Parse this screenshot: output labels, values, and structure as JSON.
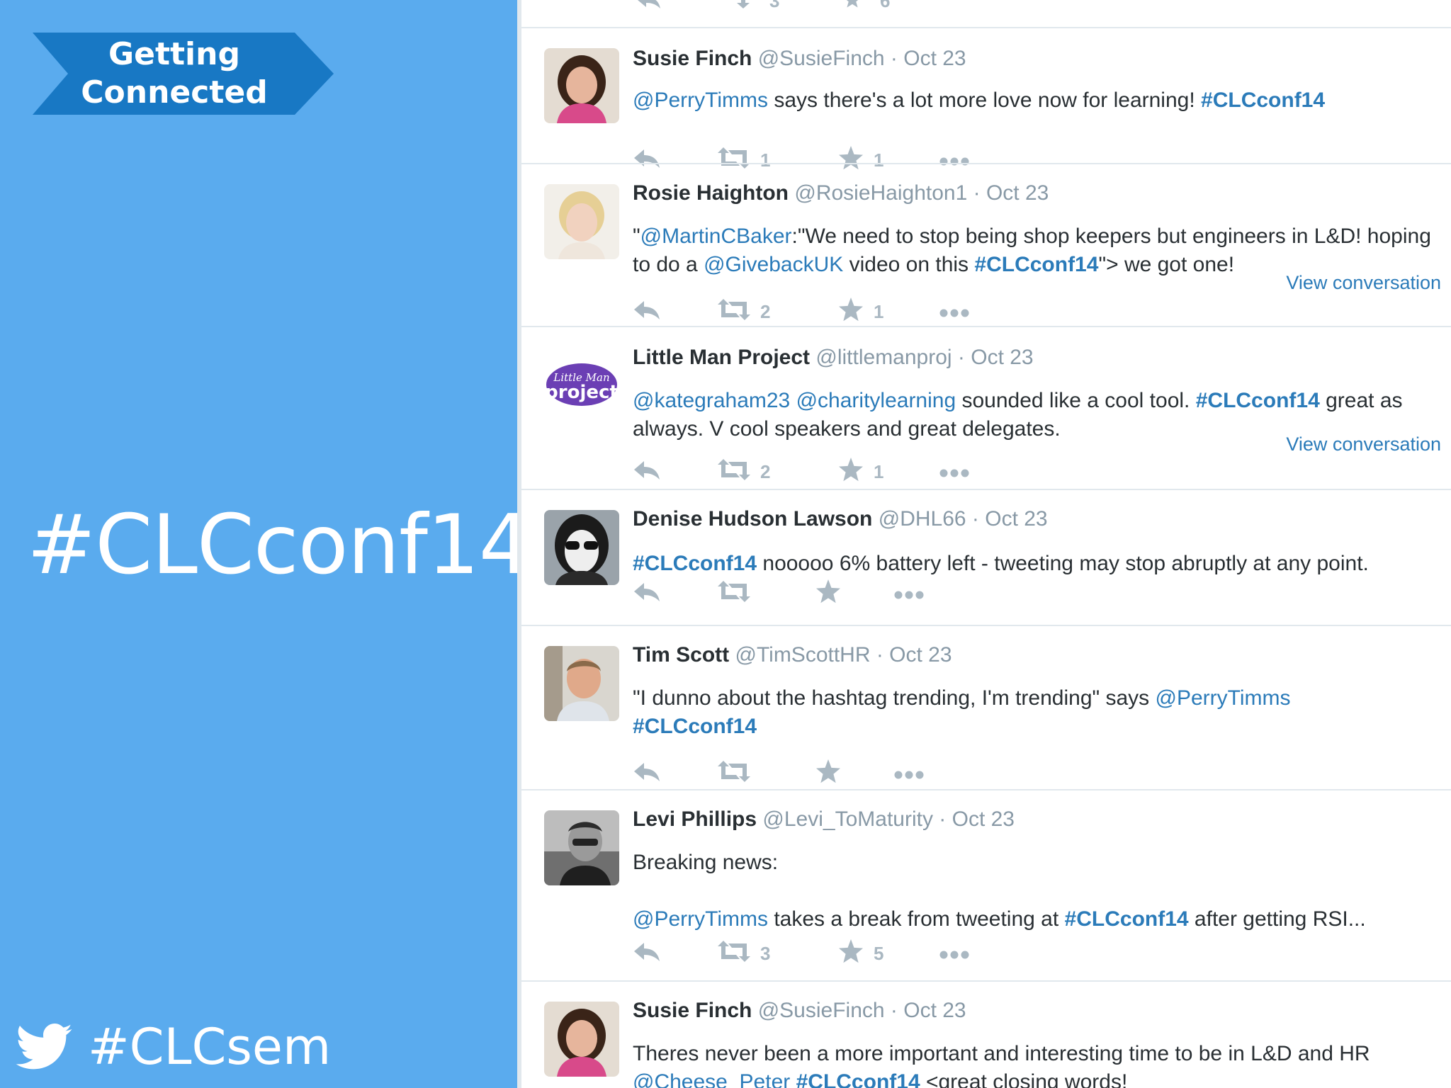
{
  "slide": {
    "banner_line1": "Getting",
    "banner_line2": "Connected",
    "big_hashtag": "#CLCconf14",
    "footer_hashtag": "#CLCsem",
    "background_color": "#5aabee",
    "banner_color": "#1878c4"
  },
  "feed": {
    "top_partial_counts": [
      "3",
      "6"
    ],
    "tweets": [
      {
        "name": "Susie Finch",
        "handle": "@SusieFinch",
        "date": "· Oct 23",
        "body": [
          {
            "t": "mention",
            "v": "@PerryTimms"
          },
          {
            "t": "text",
            "v": " says there's a lot more love now for learning! "
          },
          {
            "t": "hashtag",
            "v": "#CLCconf14"
          }
        ],
        "retweets": "1",
        "favorites": "1",
        "view_conversation": ""
      },
      {
        "name": "Rosie Haighton",
        "handle": "@RosieHaighton1",
        "date": "· Oct 23",
        "body": [
          {
            "t": "text",
            "v": "\""
          },
          {
            "t": "mention",
            "v": "@MartinCBaker"
          },
          {
            "t": "text",
            "v": ":\"We need to stop being shop keepers but engineers in L&D! hoping to do a "
          },
          {
            "t": "mention",
            "v": "@GivebackUK"
          },
          {
            "t": "text",
            "v": " video on this "
          },
          {
            "t": "hashtag",
            "v": "#CLCconf14"
          },
          {
            "t": "text",
            "v": "\"> we got one!"
          }
        ],
        "retweets": "2",
        "favorites": "1",
        "view_conversation": "View conversation"
      },
      {
        "name": "Little Man Project",
        "handle": "@littlemanproj",
        "date": "· Oct 23",
        "body": [
          {
            "t": "mention",
            "v": "@kategraham23"
          },
          {
            "t": "text",
            "v": " "
          },
          {
            "t": "mention",
            "v": "@charitylearning"
          },
          {
            "t": "text",
            "v": " sounded like a cool tool. "
          },
          {
            "t": "hashtag",
            "v": "#CLCconf14"
          },
          {
            "t": "text",
            "v": " great as always. V cool speakers and great delegates."
          }
        ],
        "retweets": "2",
        "favorites": "1",
        "view_conversation": "View conversation",
        "avatar_logo_line1": "Little Man",
        "avatar_logo_line2": "project"
      },
      {
        "name": "Denise Hudson Lawson",
        "handle": "@DHL66",
        "date": "· Oct 23",
        "body": [
          {
            "t": "hashtag",
            "v": "#CLCconf14"
          },
          {
            "t": "text",
            "v": " nooooo 6% battery left - tweeting may stop abruptly at any point."
          }
        ],
        "retweets": "",
        "favorites": "",
        "view_conversation": ""
      },
      {
        "name": "Tim Scott",
        "handle": "@TimScottHR",
        "date": "· Oct 23",
        "body": [
          {
            "t": "text",
            "v": "\"I dunno about the hashtag trending, I'm trending\" says "
          },
          {
            "t": "mention",
            "v": "@PerryTimms"
          },
          {
            "t": "br",
            "v": ""
          },
          {
            "t": "hashtag",
            "v": "#CLCconf14"
          }
        ],
        "retweets": "",
        "favorites": "",
        "view_conversation": ""
      },
      {
        "name": "Levi Phillips",
        "handle": "@Levi_ToMaturity",
        "date": "· Oct 23",
        "body": [
          {
            "t": "text",
            "v": "Breaking news:"
          },
          {
            "t": "br",
            "v": ""
          },
          {
            "t": "br",
            "v": ""
          },
          {
            "t": "mention",
            "v": "@PerryTimms"
          },
          {
            "t": "text",
            "v": " takes a break from tweeting at "
          },
          {
            "t": "hashtag",
            "v": "#CLCconf14"
          },
          {
            "t": "text",
            "v": " after getting RSI..."
          }
        ],
        "retweets": "3",
        "favorites": "5",
        "view_conversation": ""
      },
      {
        "name": "Susie Finch",
        "handle": "@SusieFinch",
        "date": "· Oct 23",
        "body": [
          {
            "t": "text",
            "v": "Theres never been a more important and interesting time to be in L&D and HR "
          },
          {
            "t": "mention",
            "v": "@Cheese_Peter"
          },
          {
            "t": "text",
            "v": " "
          },
          {
            "t": "hashtag",
            "v": "#CLCconf14"
          },
          {
            "t": "text",
            "v": " <great closing words!"
          }
        ],
        "retweets": "",
        "favorites": "",
        "view_conversation": ""
      }
    ]
  },
  "icons": {
    "reply": "reply-icon",
    "retweet": "retweet-icon",
    "favorite": "star-icon",
    "more": "more-icon",
    "bird": "twitter-bird-icon"
  }
}
